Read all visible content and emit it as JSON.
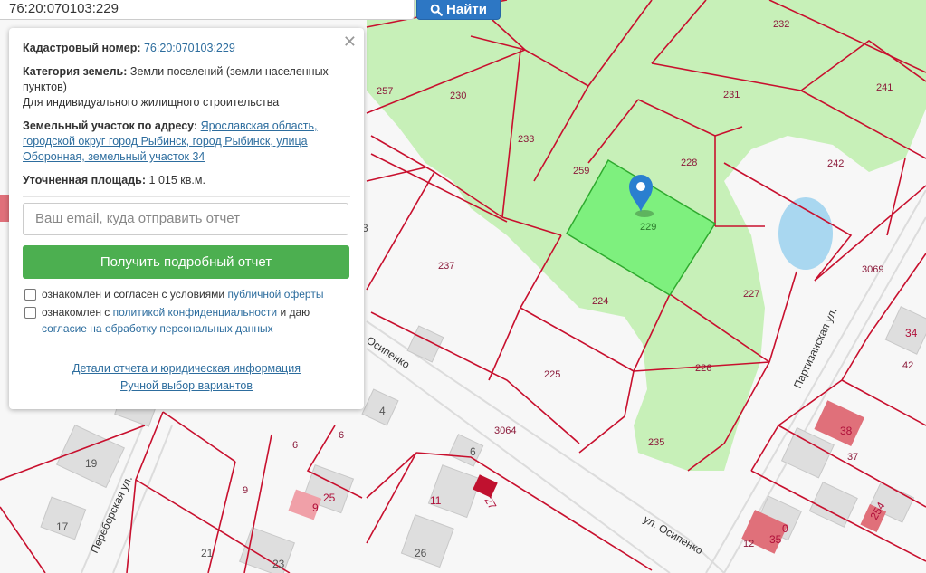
{
  "search": {
    "value": "76:20:070103:229",
    "button_label": "Найти"
  },
  "panel": {
    "cadastral_label": "Кадастровый номер:",
    "cadastral_value": "76:20:070103:229",
    "category_label": "Категория земель:",
    "category_value": "Земли поселений (земли населенных пунктов)",
    "category_use": "Для индивидуального жилищного строительства",
    "address_label": "Земельный участок по адресу:",
    "address_value": "Ярославская область, городской округ город Рыбинск, город Рыбинск, улица Оборонная, земельный участок 34",
    "area_label": "Уточненная площадь:",
    "area_value": "1 015 кв.м.",
    "email_placeholder": "Ваш email, куда отправить отчет",
    "report_button": "Получить подробный отчет",
    "consent1_text": "ознакомлен и согласен с условиями",
    "consent1_link": "публичной оферты",
    "consent2_text": "ознакомлен с",
    "consent2_link": "политикой конфиденциальности",
    "consent2_text2": "и даю",
    "consent2_link2": "согласие на обработку персональных данных",
    "details_link": "Детали отчета и юридическая информация",
    "manual_link": "Ручной выбор вариантов"
  },
  "map": {
    "selected_plot_color": "#7ef07e",
    "forest_color": "#c7f0b8",
    "boundary_color": "#c8102e",
    "plots": [
      {
        "label": "232"
      },
      {
        "label": "241"
      },
      {
        "label": "257"
      },
      {
        "label": "230"
      },
      {
        "label": "231"
      },
      {
        "label": "233"
      },
      {
        "label": "228"
      },
      {
        "label": "242"
      },
      {
        "label": "259"
      },
      {
        "label": "229"
      },
      {
        "label": "237"
      },
      {
        "label": "3069"
      },
      {
        "label": "227"
      },
      {
        "label": "224"
      },
      {
        "label": "225"
      },
      {
        "label": "226"
      },
      {
        "label": "3064"
      },
      {
        "label": "235"
      },
      {
        "label": "6"
      },
      {
        "label": "6"
      },
      {
        "label": "9"
      },
      {
        "label": "12"
      },
      {
        "label": "37"
      },
      {
        "label": "42"
      }
    ],
    "buildings": [
      {
        "label": "3"
      },
      {
        "label": "4"
      },
      {
        "label": "19"
      },
      {
        "label": "17"
      },
      {
        "label": "21"
      },
      {
        "label": "23"
      },
      {
        "label": "25"
      },
      {
        "label": "9"
      },
      {
        "label": "11"
      },
      {
        "label": "27"
      },
      {
        "label": "26"
      },
      {
        "label": "6"
      },
      {
        "label": "38"
      },
      {
        "label": "35"
      },
      {
        "label": "0"
      },
      {
        "label": "254"
      },
      {
        "label": "34"
      }
    ],
    "streets": [
      {
        "label": "ул. Осипенко"
      },
      {
        "label": "Осипенко"
      },
      {
        "label": "Переборская ул."
      },
      {
        "label": "Партизанская ул."
      }
    ],
    "marker_icon": "map-pin-icon"
  }
}
